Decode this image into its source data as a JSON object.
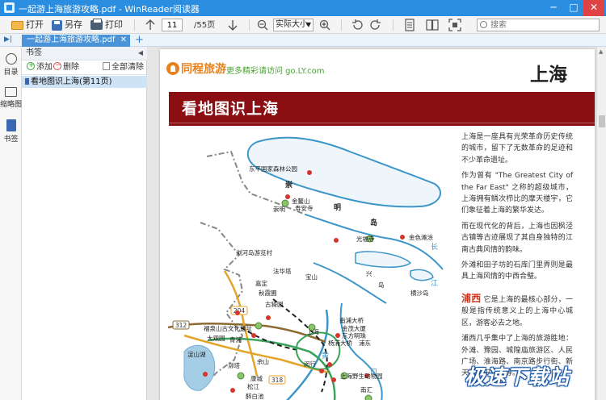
{
  "window": {
    "title": "一起游上海旅游攻略.pdf - WinReader阅读器",
    "minimize": "─",
    "maximize": "□",
    "close": "✕",
    "restore": "▣",
    "accent_color": "#2b8de0"
  },
  "toolbar": {
    "open_label": "打开",
    "saveas_label": "另存",
    "print_label": "打印",
    "up_icon": "arrow-up-icon",
    "page_current": "11",
    "page_total": "/55页",
    "down_icon": "arrow-down-icon",
    "zoom_value": "实际大小",
    "search_placeholder": "搜索"
  },
  "tabs": {
    "toggle": "▶|",
    "items": [
      {
        "label": "一起游上海旅游攻略.pdf",
        "close": "✕"
      }
    ],
    "add": "+"
  },
  "side_strip": {
    "items": [
      {
        "label": "目录",
        "icon": "toc-icon"
      },
      {
        "label": "缩略图",
        "icon": "thumbnail-icon"
      },
      {
        "label": "书签",
        "icon": "bookmark-icon"
      }
    ]
  },
  "bookmarks": {
    "header": "书签",
    "collapse": "◀",
    "add_label": "添加",
    "delete_label": "删除",
    "clear_label": "全部清除",
    "items": [
      {
        "label": "看地图识上海(第11页)"
      }
    ]
  },
  "page": {
    "brand": "同程旅游",
    "slogan": "更多精彩请访问 go.LY.com",
    "city": "上海",
    "banner": "看地图识上海",
    "map_labels": {
      "chongming_temple": "东平国家森林公园",
      "chongming": "崇明",
      "jinjiao": "金鳌山",
      "shouan": "寿安寺",
      "chong": "崇",
      "ming": "明",
      "dao": "岛",
      "guangfu": "光福寺",
      "jinse": "金色滩涂",
      "changjiang": "长",
      "yizhou": "浏河岛游览村",
      "fata": "法华塔",
      "jiading": "嘉定",
      "qiuxia": "秋霞圃",
      "baoshan": "宝山",
      "xing": "兴",
      "dao2": "岛",
      "hengsha": "横沙岛",
      "jiang": "江",
      "gu": "古猗园",
      "fuquan": "福泉山古文化遗址",
      "daguan": "大观园",
      "qingpu": "青浦",
      "dianshan": "淀山湖",
      "shanghai": "上海",
      "puxi": "南浦大桥",
      "jinmao": "金茂大厦",
      "oriental": "东方明珠",
      "lujiazui": "杨浦大桥",
      "pudong": "浦东",
      "yangshan": "余山",
      "zhujiajiao": "泖塔",
      "songjiang": "松江",
      "minhang": "闵行",
      "wildlife": "上海野生动物园",
      "nanhui": "南汇",
      "kouhui": "口",
      "kangjian": "醉白池",
      "kang": "康城",
      "r312": "312",
      "r204": "204",
      "r318": "318",
      "r320": "320",
      "huangpu": "黄"
    },
    "paragraphs": [
      "上海是一座具有光荣革命历史传统的城市，留下了无数革命的足迹和不少革命遗址。",
      "作为曾有 \"The Greatest City of the Far East\" 之称的超级城市，上海拥有鳞次栉比的摩天楼宇，它们象征着上海的繁华发达。",
      "而在现代化的背后，上海也因枫泾古镇等古迹展现了其自身独特的江南古典风情的韵味。",
      "外滩和田子坊的石库门里弄则是最具上海风情的中西合璧。"
    ],
    "puxi_heading": "浦西",
    "puxi_text": "它是上海的最核心部分，一般是指传统意义上的上海中心城区，游客必去之地。",
    "last_paragraph": "浦西几乎集中了上海的旅游胜地：外滩、豫园、城隍庙旅游区、人民广场、淮海路、南京路步行街、新天地、田子坊等。"
  },
  "watermark": "极速下载站"
}
